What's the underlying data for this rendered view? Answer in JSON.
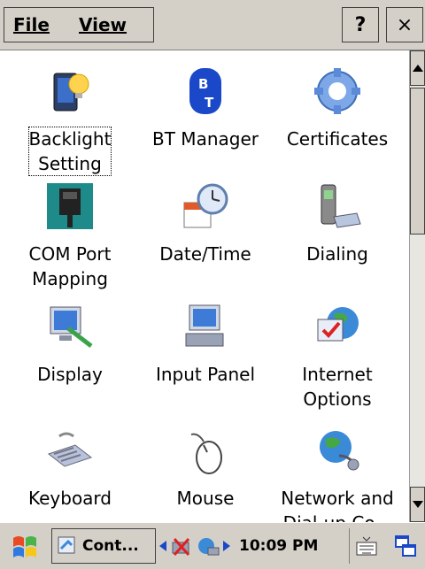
{
  "menu": {
    "file_label": "File",
    "view_label": "View",
    "help_label": "?",
    "close_label": "×"
  },
  "items": [
    {
      "label1": "Backlight",
      "label2": "Setting",
      "icon": "backlight-icon"
    },
    {
      "label1": "BT Manager",
      "label2": "",
      "icon": "bt-manager-icon"
    },
    {
      "label1": "Certificates",
      "label2": "",
      "icon": "certificates-icon"
    },
    {
      "label1": "COM Port",
      "label2": "Mapping",
      "icon": "com-port-icon"
    },
    {
      "label1": "Date/Time",
      "label2": "",
      "icon": "date-time-icon"
    },
    {
      "label1": "Dialing",
      "label2": "",
      "icon": "dialing-icon"
    },
    {
      "label1": "Display",
      "label2": "",
      "icon": "display-icon"
    },
    {
      "label1": "Input Panel",
      "label2": "",
      "icon": "input-panel-icon"
    },
    {
      "label1": "Internet",
      "label2": "Options",
      "icon": "internet-options-icon"
    },
    {
      "label1": "Keyboard",
      "label2": "",
      "icon": "keyboard-icon"
    },
    {
      "label1": "Mouse",
      "label2": "",
      "icon": "mouse-icon"
    },
    {
      "label1": "Network and",
      "label2": "Dial-up Co...",
      "icon": "network-icon"
    }
  ],
  "taskbar": {
    "task_label": "Cont...",
    "clock": "10:09 PM"
  }
}
